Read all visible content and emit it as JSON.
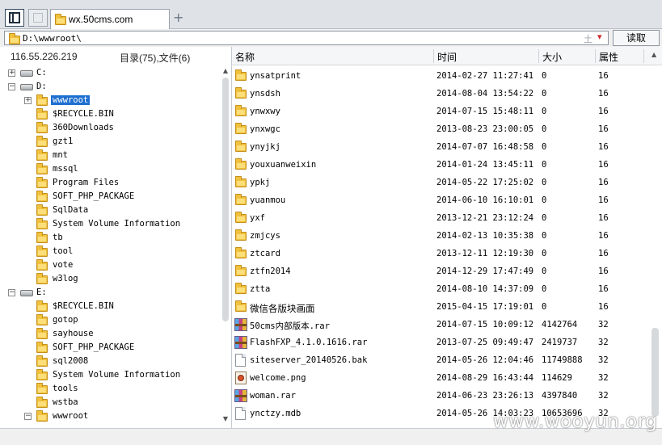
{
  "tab": {
    "label": "wx.50cms.com",
    "add_label": "+"
  },
  "address": {
    "path": "D:\\wwwroot\\",
    "pin_icon": "土",
    "dropdown_icon": "▾",
    "read_button": "读取"
  },
  "left": {
    "ip": "116.55.226.219",
    "counts": "目录(75),文件(6)",
    "tree": [
      {
        "type": "drive",
        "label": "C:",
        "expander": "+",
        "level": 0
      },
      {
        "type": "drive",
        "label": "D:",
        "expander": "−",
        "level": 0
      },
      {
        "type": "folder",
        "label": "wwwroot",
        "expander": "+",
        "level": 1,
        "selected": true
      },
      {
        "type": "folder",
        "label": "$RECYCLE.BIN",
        "level": 1
      },
      {
        "type": "folder",
        "label": "360Downloads",
        "level": 1
      },
      {
        "type": "folder",
        "label": "gzt1",
        "level": 1
      },
      {
        "type": "folder",
        "label": "mnt",
        "level": 1
      },
      {
        "type": "folder",
        "label": "mssql",
        "level": 1
      },
      {
        "type": "folder",
        "label": "Program Files",
        "level": 1
      },
      {
        "type": "folder",
        "label": "SOFT_PHP_PACKAGE",
        "level": 1
      },
      {
        "type": "folder",
        "label": "SqlData",
        "level": 1
      },
      {
        "type": "folder",
        "label": "System Volume Information",
        "level": 1
      },
      {
        "type": "folder",
        "label": "tb",
        "level": 1
      },
      {
        "type": "folder",
        "label": "tool",
        "level": 1
      },
      {
        "type": "folder",
        "label": "vote",
        "level": 1
      },
      {
        "type": "folder",
        "label": "w3log",
        "level": 1
      },
      {
        "type": "drive",
        "label": "E:",
        "expander": "−",
        "level": 0
      },
      {
        "type": "folder",
        "label": "$RECYCLE.BIN",
        "level": 1
      },
      {
        "type": "folder",
        "label": "gotop",
        "level": 1
      },
      {
        "type": "folder",
        "label": "sayhouse",
        "level": 1
      },
      {
        "type": "folder",
        "label": "SOFT_PHP_PACKAGE",
        "level": 1
      },
      {
        "type": "folder",
        "label": "sql2008",
        "level": 1
      },
      {
        "type": "folder",
        "label": "System Volume Information",
        "level": 1
      },
      {
        "type": "folder",
        "label": "tools",
        "level": 1
      },
      {
        "type": "folder",
        "label": "wstba",
        "level": 1
      },
      {
        "type": "folder",
        "label": "wwwroot",
        "expander": "−",
        "level": 1
      }
    ]
  },
  "columns": {
    "name": "名称",
    "time": "时间",
    "size": "大小",
    "attr": "属性"
  },
  "files": [
    {
      "icon": "folder-icon",
      "name": "ynsatprint",
      "time": "2014-02-27 11:27:41",
      "size": "0",
      "attr": "16"
    },
    {
      "icon": "folder-icon",
      "name": "ynsdsh",
      "time": "2014-08-04 13:54:22",
      "size": "0",
      "attr": "16"
    },
    {
      "icon": "folder-icon",
      "name": "ynwxwy",
      "time": "2014-07-15 15:48:11",
      "size": "0",
      "attr": "16"
    },
    {
      "icon": "folder-icon",
      "name": "ynxwgc",
      "time": "2013-08-23 23:00:05",
      "size": "0",
      "attr": "16"
    },
    {
      "icon": "folder-icon",
      "name": "ynyjkj",
      "time": "2014-07-07 16:48:58",
      "size": "0",
      "attr": "16"
    },
    {
      "icon": "folder-icon",
      "name": "youxuanweixin",
      "time": "2014-01-24 13:45:11",
      "size": "0",
      "attr": "16"
    },
    {
      "icon": "folder-icon",
      "name": "ypkj",
      "time": "2014-05-22 17:25:02",
      "size": "0",
      "attr": "16"
    },
    {
      "icon": "folder-icon",
      "name": "yuanmou",
      "time": "2014-06-10 16:10:01",
      "size": "0",
      "attr": "16"
    },
    {
      "icon": "folder-icon",
      "name": "yxf",
      "time": "2013-12-21 23:12:24",
      "size": "0",
      "attr": "16"
    },
    {
      "icon": "folder-icon",
      "name": "zmjcys",
      "time": "2014-02-13 10:35:38",
      "size": "0",
      "attr": "16"
    },
    {
      "icon": "folder-icon",
      "name": "ztcard",
      "time": "2013-12-11 12:19:30",
      "size": "0",
      "attr": "16"
    },
    {
      "icon": "folder-icon",
      "name": "ztfn2014",
      "time": "2014-12-29 17:47:49",
      "size": "0",
      "attr": "16"
    },
    {
      "icon": "folder-icon",
      "name": "ztta",
      "time": "2014-08-10 14:37:09",
      "size": "0",
      "attr": "16"
    },
    {
      "icon": "folder-icon",
      "name": "微信各版块画面",
      "time": "2015-04-15 17:19:01",
      "size": "0",
      "attr": "16",
      "cjk": true
    },
    {
      "icon": "rar-icon",
      "name": "50cms内部版本.rar",
      "time": "2014-07-15 10:09:12",
      "size": "4142764",
      "attr": "32"
    },
    {
      "icon": "rar-icon",
      "name": "FlashFXP_4.1.0.1616.rar",
      "time": "2013-07-25 09:49:47",
      "size": "2419737",
      "attr": "32"
    },
    {
      "icon": "bak-icon",
      "name": "siteserver_20140526.bak",
      "time": "2014-05-26 12:04:46",
      "size": "11749888",
      "attr": "32"
    },
    {
      "icon": "png-icon",
      "name": "welcome.png",
      "time": "2014-08-29 16:43:44",
      "size": "114629",
      "attr": "32"
    },
    {
      "icon": "rar-icon",
      "name": "woman.rar",
      "time": "2014-06-23 23:26:13",
      "size": "4397840",
      "attr": "32"
    },
    {
      "icon": "bak-icon",
      "name": "ynctzy.mdb",
      "time": "2014-05-26 14:03:23",
      "size": "10653696",
      "attr": "32"
    }
  ],
  "watermark": "www.wooyun.org"
}
